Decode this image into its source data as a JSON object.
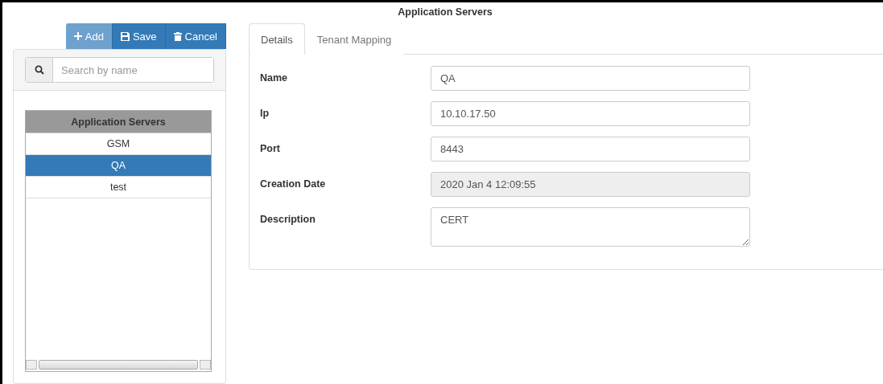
{
  "title": "Application Servers",
  "toolbar": [
    {
      "kind": "add",
      "label": "Add",
      "disabled": true
    },
    {
      "kind": "save",
      "label": "Save",
      "disabled": false
    },
    {
      "kind": "cancel",
      "label": "Cancel",
      "disabled": false
    }
  ],
  "search": {
    "placeholder": "Search by name"
  },
  "list": {
    "header": "Application Servers",
    "items": [
      {
        "label": "GSM",
        "selected": false
      },
      {
        "label": "QA",
        "selected": true
      },
      {
        "label": "test",
        "selected": false
      }
    ]
  },
  "tabs": [
    {
      "label": "Details",
      "selected": true
    },
    {
      "label": "Tenant Mapping",
      "selected": false
    }
  ],
  "fields": [
    {
      "label": "Name",
      "value": "QA",
      "kind": "text",
      "disabled": false
    },
    {
      "label": "Ip",
      "value": "10.10.17.50",
      "kind": "text",
      "disabled": false
    },
    {
      "label": "Port",
      "value": "8443",
      "kind": "text",
      "disabled": false
    },
    {
      "label": "Creation Date",
      "value": "2020 Jan 4 12:09:55",
      "kind": "text",
      "disabled": true
    },
    {
      "label": "Description",
      "value": "CERT",
      "kind": "textarea",
      "disabled": false
    }
  ]
}
